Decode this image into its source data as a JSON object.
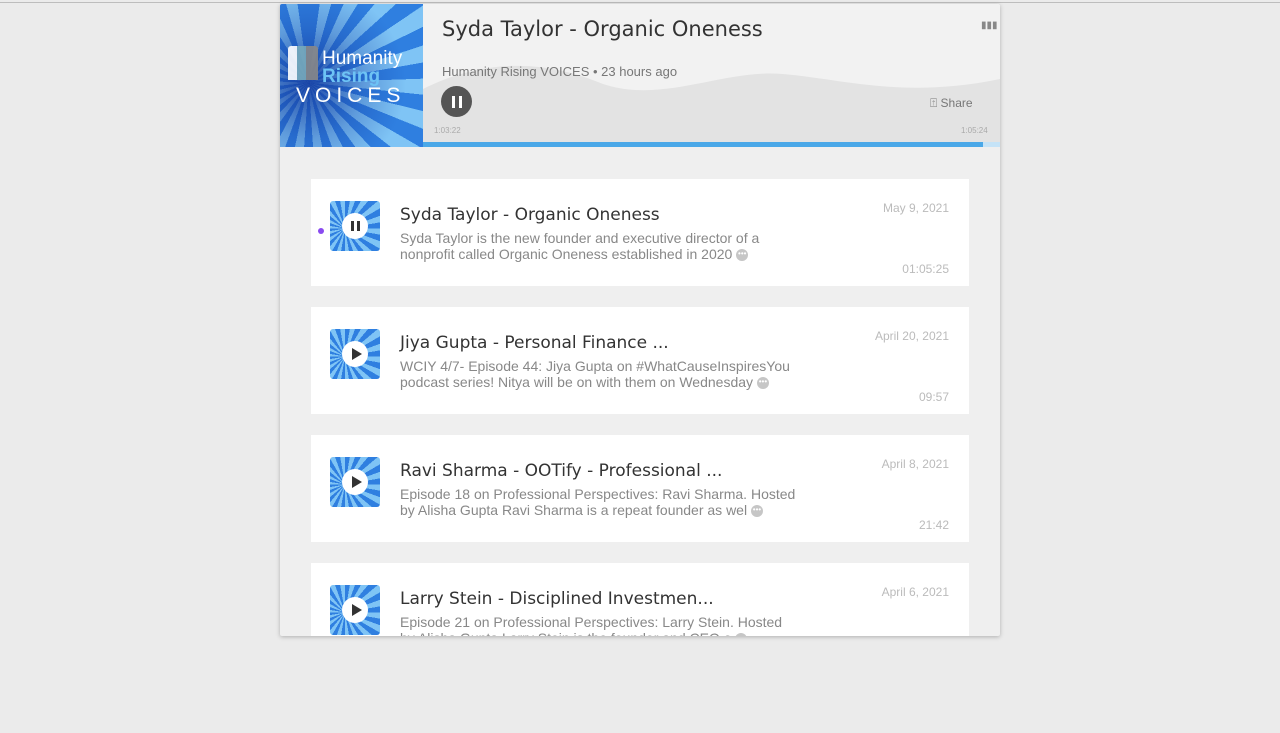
{
  "player": {
    "title": "Syda Taylor - Organic Oneness",
    "subtitle": "Humanity Rising VOICES • 23 hours ago",
    "logo_text": [
      "Humanity",
      "Rising",
      "VOICES"
    ],
    "share_label": "Share",
    "current_time": "1:03:22",
    "total_time": "1:05:24",
    "progress_percent": 97,
    "state": "playing"
  },
  "episodes": [
    {
      "title": "Syda Taylor - Organic Oneness",
      "desc1": "Syda Taylor is the new founder and executive director of a",
      "desc2": "nonprofit called Organic Oneness established in 2020",
      "date": "May 9, 2021",
      "duration": "01:05:25",
      "playing": true
    },
    {
      "title": "Jiya Gupta - Personal Finance ...",
      "desc1": "WCIY 4/7- Episode 44: Jiya Gupta on #WhatCauseInspiresYou",
      "desc2": "podcast series! Nitya will be on with them on Wednesday",
      "date": "April 20, 2021",
      "duration": "09:57",
      "playing": false
    },
    {
      "title": "Ravi Sharma - OOTify - Professional ...",
      "desc1": "Episode 18 on Professional Perspectives: Ravi Sharma. Hosted",
      "desc2": "by Alisha Gupta   Ravi Sharma is a repeat founder as wel",
      "date": "April 8, 2021",
      "duration": "21:42",
      "playing": false
    },
    {
      "title": "Larry Stein - Disciplined Investmen...",
      "desc1": "Episode 21 on Professional Perspectives: Larry Stein. Hosted",
      "desc2": "by Alisha Gupta   Larry Stein is the founder and CEO o",
      "date": "April 6, 2021",
      "duration": "",
      "playing": false
    }
  ],
  "colors": {
    "accent": "#4aa8e8",
    "now_playing_dot": "#8a4af0"
  }
}
